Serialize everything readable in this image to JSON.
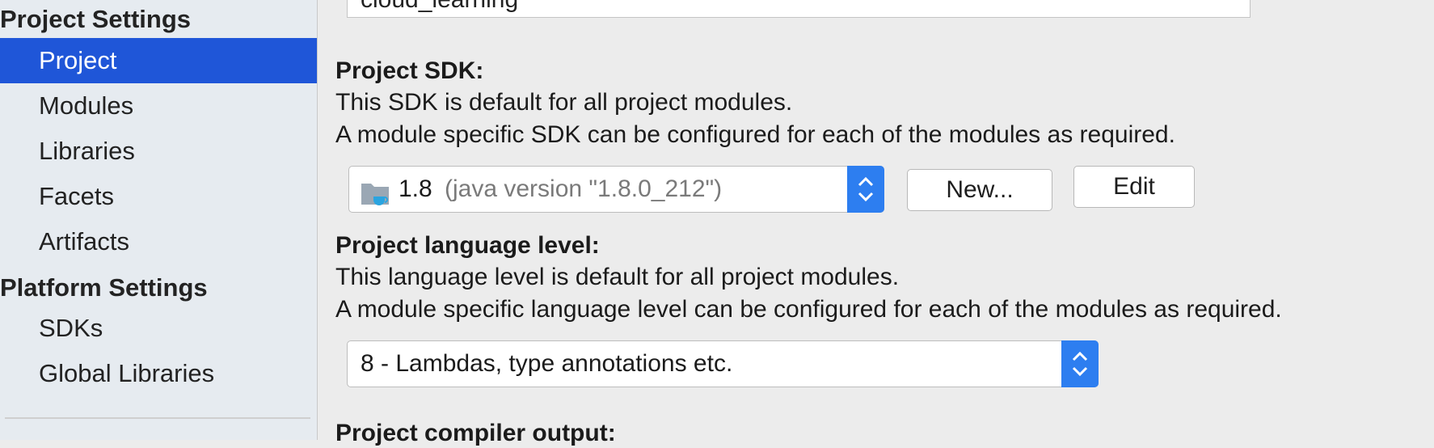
{
  "sidebar": {
    "project_settings_header": "Project Settings",
    "platform_settings_header": "Platform Settings",
    "project_items": [
      "Project",
      "Modules",
      "Libraries",
      "Facets",
      "Artifacts"
    ],
    "platform_items": [
      "SDKs",
      "Global Libraries"
    ],
    "selected": "Project"
  },
  "main": {
    "name_value": "cloud_learning",
    "sdk": {
      "heading": "Project SDK:",
      "desc1": "This SDK is default for all project modules.",
      "desc2": "A module specific SDK can be configured for each of the modules as required.",
      "selected_version": "1.8",
      "selected_detail": "(java version \"1.8.0_212\")",
      "icon": "java-sdk-folder-icon",
      "new_button": "New...",
      "edit_button": "Edit"
    },
    "language": {
      "heading": "Project language level:",
      "desc1": "This language level is default for all project modules.",
      "desc2": "A module specific language level can be configured for each of the modules as required.",
      "selected": "8 - Lambdas, type annotations etc."
    },
    "compiler_heading": "Project compiler output:"
  },
  "colors": {
    "selection": "#1f56d8",
    "combo_arrow": "#2d7ef0",
    "sidebar_bg": "#e6ebf0",
    "panel_bg": "#ececec"
  }
}
